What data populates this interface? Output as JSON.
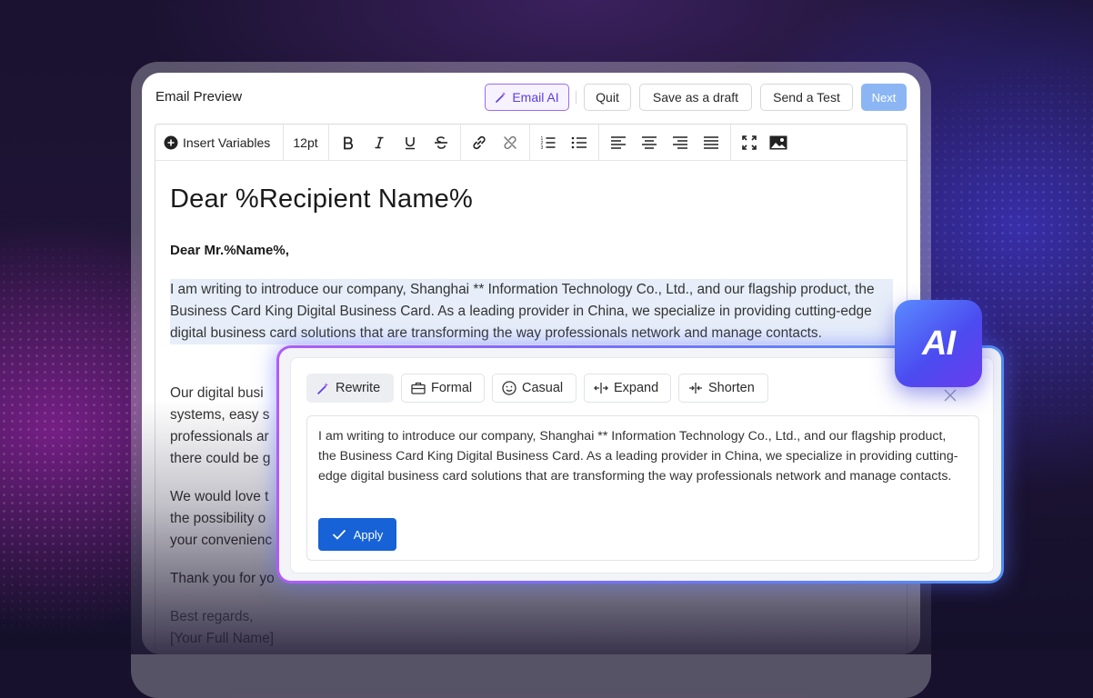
{
  "header": {
    "title": "Email Preview",
    "email_ai_label": "Email AI",
    "quit_label": "Quit",
    "save_draft_label": "Save as a draft",
    "send_test_label": "Send a Test",
    "next_label": "Next"
  },
  "toolbar": {
    "insert_variables_label": "Insert Variables",
    "font_size": "12pt",
    "icons": [
      "plus-circle-icon",
      "bold-icon",
      "italic-icon",
      "underline-icon",
      "strikethrough-icon",
      "link-icon",
      "unlink-icon",
      "ordered-list-icon",
      "bullet-list-icon",
      "align-left-icon",
      "align-center-icon",
      "align-right-icon",
      "align-justify-icon",
      "fullscreen-icon",
      "image-icon"
    ]
  },
  "email": {
    "heading": "Dear %Recipient Name%",
    "greeting": "Dear Mr.%Name%,",
    "para1": "I am writing to introduce our company, Shanghai ** Information Technology Co., Ltd., and our flagship product, the Business Card King Digital Business Card. As a leading provider in China, we specialize in providing cutting-edge digital business card solutions that are transforming the way professionals network and manage contacts.",
    "para2_visible_lines": [
      "Our digital busi",
      "systems, easy s",
      "professionals ar",
      "there could be g"
    ],
    "para3_visible_lines": [
      "We would love t",
      "the possibility o",
      "your convenienc"
    ],
    "thanks": "Thank you for yo",
    "closing": "Best regards,",
    "signature": "[Your Full Name]"
  },
  "ai_panel": {
    "actions": [
      "Rewrite",
      "Formal",
      "Casual",
      "Expand",
      "Shorten"
    ],
    "active_action": "Rewrite",
    "result_text": "I am writing to introduce our company, Shanghai ** Information Technology Co., Ltd., and our flagship product, the Business Card King Digital Business Card. As a leading provider in China, we specialize in providing cutting-edge digital business card solutions that are transforming the way professionals network and manage contacts.",
    "apply_label": "Apply",
    "badge_text": "AI"
  },
  "colors": {
    "accent_blue": "#1662d6",
    "next_button": "#8cb6f3",
    "ai_purple": "#9a6cf0",
    "highlight": "#e7eef9"
  }
}
